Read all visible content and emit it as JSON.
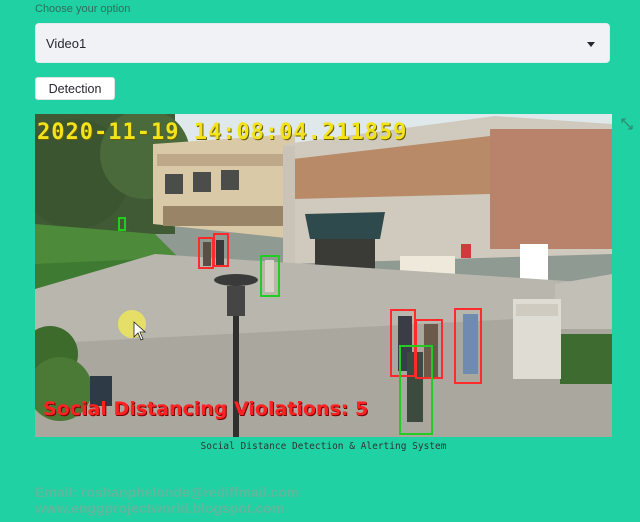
{
  "selector": {
    "label": "Choose your option",
    "value": "Video1",
    "icon": "chevron-down-icon"
  },
  "detection_button": {
    "label": "Detection"
  },
  "video": {
    "timestamp": "2020-11-19 14:08:04.211859",
    "violations_text": "Social Distancing Violations: 5",
    "expand_icon": "expand-icon"
  },
  "caption": "Social Distance Detection & Alerting System",
  "footer": {
    "email": "Email: roshanphelonde@rediffmail.com",
    "website": "www.enggprojectworld.blogspot.com"
  },
  "colors": {
    "background": "#1fd1a3",
    "violation_box": "#ff2a2a",
    "safe_box": "#22cc22",
    "timestamp": "#f2e31b"
  }
}
